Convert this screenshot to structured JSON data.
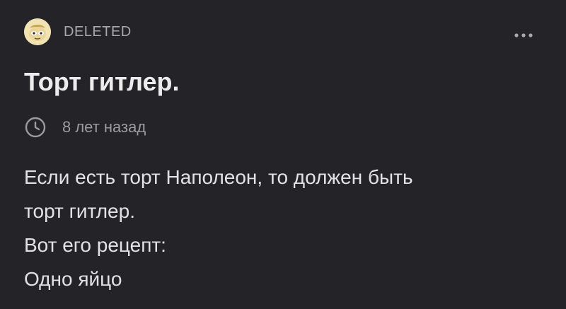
{
  "post": {
    "author": "DELETED",
    "title": "Торт гитлер.",
    "time": "8 лет назад",
    "body_lines": [
      "Если есть торт Наполеон, то должен быть",
      "торт гитлер.",
      "Вот его рецепт:",
      "Одно яйцо"
    ]
  },
  "icons": {
    "avatar": "deleted-user-avatar",
    "more": "more-horizontal-icon",
    "clock": "clock-icon"
  },
  "colors": {
    "background": "#242428",
    "title": "#ececec",
    "muted": "#9c9ca0",
    "avatar_bg": "#f2e3b2"
  }
}
